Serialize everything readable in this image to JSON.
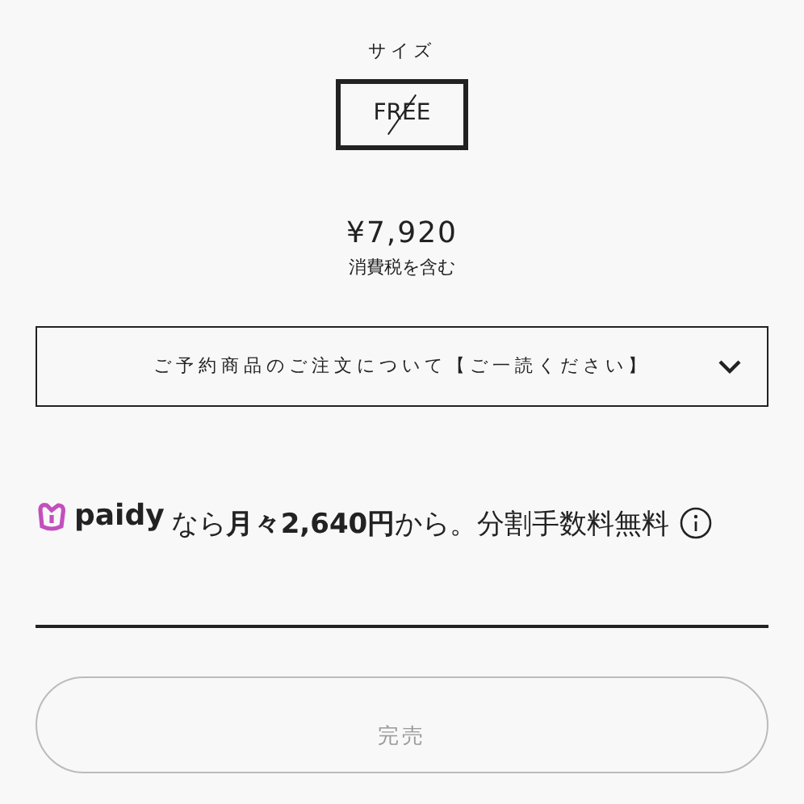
{
  "size_label": "サイズ",
  "sizes": [
    {
      "label": "FREE",
      "selected": true,
      "sold_out": true
    }
  ],
  "price": "¥7,920",
  "tax_note": "消費税を含む",
  "accordion": {
    "title": "ご予約商品のご注文について【ご一読ください】",
    "expanded": false
  },
  "paidy": {
    "logo": "paidy",
    "text": "なら**月々2,640円**から。分割手数料無料"
  },
  "cart_button": {
    "label": "完売",
    "disabled": true
  }
}
